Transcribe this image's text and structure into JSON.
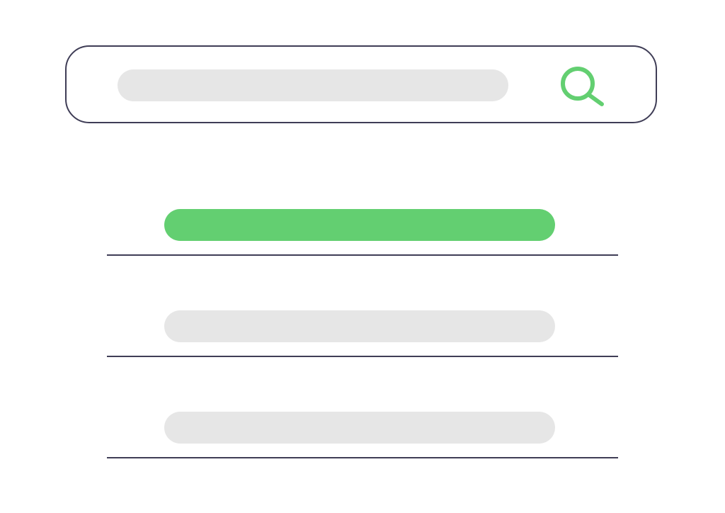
{
  "search": {
    "value": "",
    "placeholder": "",
    "colors": {
      "border": "#3f3d56",
      "input_fill": "#e6e6e6",
      "icon": "#63cf71"
    },
    "icon": "search-icon"
  },
  "results": {
    "items": [
      {
        "selected": true
      },
      {
        "selected": false
      },
      {
        "selected": false
      }
    ],
    "colors": {
      "selected_fill": "#63cf71",
      "placeholder_fill": "#e6e6e6",
      "divider": "#3f3d56"
    }
  }
}
